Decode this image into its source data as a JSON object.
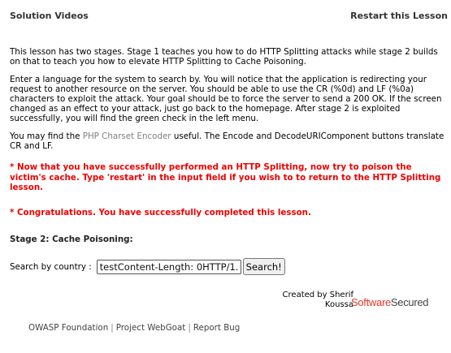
{
  "header": {
    "left_link": "Solution Videos",
    "right_link": "Restart this Lesson"
  },
  "intro": {
    "para1": "This lesson has two stages. Stage 1 teaches you how to do HTTP Splitting attacks while stage 2 builds on that to teach you how to elevate HTTP Splitting to Cache Poisoning.",
    "para2": "Enter a language for the system to search by. You will notice that the application is redirecting your request to another resource on the server. You should be able to use the CR (%0d) and LF (%0a) characters to exploit the attack. Your goal should be to force the server to send a 200 OK. If the screen changed as an effect to your attack, just go back to the homepage. After stage 2 is exploited successfully, you will find the green check in the left menu.",
    "para3_prefix": "You may find the ",
    "para3_link": "PHP Charset Encoder",
    "para3_suffix": " useful. The Encode and DecodeURIComponent buttons translate CR and LF."
  },
  "messages": {
    "stage_msg": "* Now that you have successfully performed an HTTP Splitting, now try to poison the victim's cache. Type 'restart' in the input field if you wish to to return to the HTTP Splitting lesson.",
    "congrats": "* Congratulations. You have successfully completed this lesson."
  },
  "stage_title": "Stage 2: Cache Poisoning:",
  "search": {
    "label": "Search by country :",
    "value": "testContent-Length: 0HTTP/1.",
    "button": "Search!"
  },
  "credits": {
    "created_by": "Created by Sherif Koussa",
    "logo_part1": "Software",
    "logo_part2": "Secured"
  },
  "footer": {
    "links": [
      "OWASP Foundation",
      "Project WebGoat",
      "Report Bug"
    ],
    "separator": "|"
  }
}
